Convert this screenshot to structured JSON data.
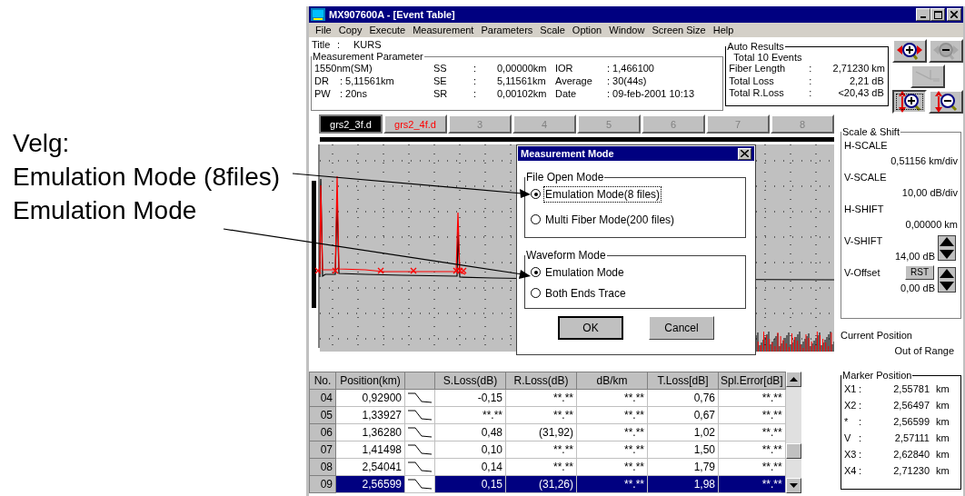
{
  "annotation": {
    "lines": [
      "Velg:",
      "Emulation Mode (8files)",
      "Emulation Mode"
    ]
  },
  "window": {
    "title": "MX907600A - [Event Table]"
  },
  "menu": [
    "File",
    "Copy",
    "Execute",
    "Measurement",
    "Parameters",
    "Scale",
    "Option",
    "Window",
    "Screen Size",
    "Help"
  ],
  "info": {
    "title_label": "Title",
    "title_sep": ":",
    "title_value": "KURS"
  },
  "measurement_parameter": {
    "title": "Measurement Parameter",
    "rows": [
      {
        "a": "1550nm(SM)",
        "key": "SS",
        "sep": ":",
        "val": "0,00000km",
        "key2": "IOR",
        "val2": ": 1,466100"
      },
      {
        "a": "DR",
        "b": ": 5,11561km",
        "key": "SE",
        "sep": ":",
        "val": "5,11561km",
        "key2": "Average",
        "val2": ": 30(44s)"
      },
      {
        "a": "PW",
        "b": ": 20ns",
        "key": "SR",
        "sep": ":",
        "val": "0,00102km",
        "key2": "Date",
        "val2": ": 09-feb-2001 10:13"
      }
    ]
  },
  "auto_results": {
    "title": "Auto Results",
    "summary": "Total 10 Events",
    "rows": [
      {
        "label": "Fiber Length",
        "sep": ":",
        "value": "2,71230",
        "unit": "km"
      },
      {
        "label": "Total Loss",
        "sep": ":",
        "value": "2,21",
        "unit": "dB"
      },
      {
        "label": "Total R.Loss",
        "sep": ":",
        "value": "<20,43",
        "unit": "dB"
      }
    ]
  },
  "toolbar": [
    {
      "kind": "h-zoom-in",
      "disabled": false,
      "selected": false
    },
    {
      "kind": "h-zoom-out",
      "disabled": true,
      "selected": false
    },
    {
      "kind": "marker",
      "disabled": true,
      "selected": false
    },
    {
      "kind": "v-zoom-in",
      "disabled": false,
      "selected": true
    },
    {
      "kind": "v-zoom-out",
      "disabled": false,
      "selected": false
    }
  ],
  "tabs": [
    {
      "label": "grs2_3f.d",
      "selected": true,
      "kind": "file"
    },
    {
      "label": "grs2_4f.d",
      "selected": false,
      "kind": "file"
    },
    {
      "label": "3",
      "selected": false,
      "kind": "empty"
    },
    {
      "label": "4",
      "selected": false,
      "kind": "empty"
    },
    {
      "label": "5",
      "selected": false,
      "kind": "empty"
    },
    {
      "label": "6",
      "selected": false,
      "kind": "empty"
    },
    {
      "label": "7",
      "selected": false,
      "kind": "empty"
    },
    {
      "label": "8",
      "selected": false,
      "kind": "empty"
    }
  ],
  "dialog": {
    "title": "Measurement Mode",
    "groups": [
      {
        "title": "File Open Mode",
        "options": [
          {
            "label": "Emulation Mode(8 files)",
            "selected": true,
            "focused": true
          },
          {
            "label": "Multi Fiber Mode(200 files)",
            "selected": false,
            "focused": false
          }
        ]
      },
      {
        "title": "Waveform Mode",
        "options": [
          {
            "label": "Emulation Mode",
            "selected": true,
            "focused": false
          },
          {
            "label": "Both Ends Trace",
            "selected": false,
            "focused": false
          }
        ]
      }
    ],
    "buttons": [
      {
        "label": "OK",
        "default": true
      },
      {
        "label": "Cancel",
        "default": false
      }
    ]
  },
  "scale_shift": {
    "title": "Scale & Shift",
    "items": [
      {
        "kind": "plain",
        "label": "H-SCALE",
        "value": "0,51156 km/div"
      },
      {
        "kind": "plain",
        "label": "V-SCALE",
        "value": "10,00 dB/div"
      },
      {
        "kind": "plain",
        "label": "H-SHIFT",
        "value": "0,00000 km"
      },
      {
        "kind": "spin",
        "label": "V-SHIFT",
        "value": "14,00 dB"
      },
      {
        "kind": "reset-spin",
        "label": "V-Offset",
        "value": "0,00 dB",
        "button": "RST"
      }
    ]
  },
  "current_position": {
    "label": "Current Position",
    "value": "Out of Range"
  },
  "marker_position": {
    "title": "Marker Position",
    "rows": [
      {
        "label": "X1",
        "sep": ":",
        "value": "2,55781",
        "unit": "km"
      },
      {
        "label": "X2",
        "sep": ":",
        "value": "2,56497",
        "unit": "km"
      },
      {
        "label": "*",
        "sep": ":",
        "value": "2,56599",
        "unit": "km"
      },
      {
        "label": "V",
        "sep": ":",
        "value": "2,57111",
        "unit": "km"
      },
      {
        "label": "X3",
        "sep": ":",
        "value": "2,62840",
        "unit": "km"
      },
      {
        "label": "X4",
        "sep": ":",
        "value": "2,71230",
        "unit": "km"
      }
    ]
  },
  "table": {
    "columns": [
      {
        "kind": "text",
        "label": "No."
      },
      {
        "kind": "text",
        "label": "Position(km)"
      },
      {
        "kind": "shape"
      },
      {
        "kind": "text",
        "label": "S.Loss(dB)"
      },
      {
        "kind": "text",
        "label": "R.Loss(dB)"
      },
      {
        "kind": "text",
        "label": "dB/km"
      },
      {
        "kind": "text",
        "label": "T.Loss[dB]"
      },
      {
        "kind": "text",
        "label": "Spl.Error[dB]"
      }
    ],
    "rows": [
      {
        "cells": [
          "04",
          "0,92900",
          "",
          "-0,15",
          "**.**",
          "**.**",
          "0,76",
          "**.**"
        ],
        "selected": false
      },
      {
        "cells": [
          "05",
          "1,33927",
          "",
          "**.**",
          "**.**",
          "**.**",
          "0,67",
          "**.**"
        ],
        "selected": false
      },
      {
        "cells": [
          "06",
          "1,36280",
          "",
          "0,48",
          "(31,92)",
          "**.**",
          "1,02",
          "**.**"
        ],
        "selected": false
      },
      {
        "cells": [
          "07",
          "1,41498",
          "",
          "0,10",
          "**.**",
          "**.**",
          "1,50",
          "**.**"
        ],
        "selected": false
      },
      {
        "cells": [
          "08",
          "2,54041",
          "",
          "0,14",
          "**.**",
          "**.**",
          "1,79",
          "**.**"
        ],
        "selected": false
      },
      {
        "cells": [
          "09",
          "2,56599",
          "",
          "0,15",
          "(31,26)",
          "**.**",
          "1,98",
          "**.**"
        ],
        "selected": true
      }
    ]
  }
}
